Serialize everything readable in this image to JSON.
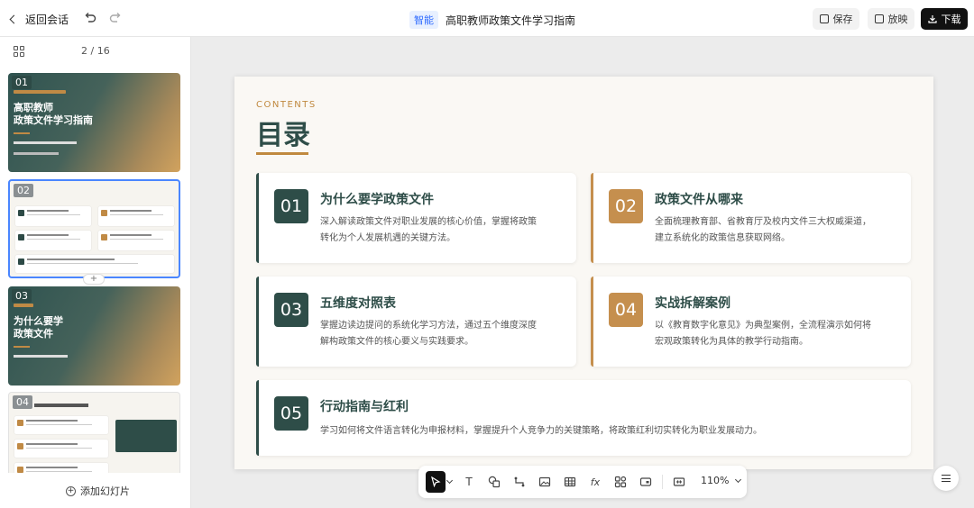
{
  "topbar": {
    "back_label": "返回会话",
    "ai_badge": "智能",
    "doc_title": "高职教师政策文件学习指南",
    "save_label": "保存",
    "present_label": "放映",
    "download_label": "下载"
  },
  "sidebar": {
    "pager": "2 / 16",
    "add_slide_label": "添加幻灯片",
    "thumbnails": [
      {
        "num": "01",
        "title_line1": "高职教师",
        "title_line2": "政策文件学习指南"
      },
      {
        "num": "02"
      },
      {
        "num": "03",
        "title_line1": "为什么要学",
        "title_line2": "政策文件"
      },
      {
        "num": "04"
      }
    ]
  },
  "slide": {
    "eyebrow": "CONTENTS",
    "heading": "目录",
    "items": [
      {
        "num": "01",
        "title": "为什么要学政策文件",
        "desc1": "深入解读政策文件对职业发展的核心价值，掌握将政策",
        "desc2": "转化为个人发展机遇的关键方法。"
      },
      {
        "num": "02",
        "title": "政策文件从哪来",
        "desc1": "全面梳理教育部、省教育厅及校内文件三大权威渠道，",
        "desc2": "建立系统化的政策信息获取网络。"
      },
      {
        "num": "03",
        "title": "五维度对照表",
        "desc1": "掌握边读边提问的系统化学习方法，通过五个维度深度",
        "desc2": "解构政策文件的核心要义与实践要求。"
      },
      {
        "num": "04",
        "title": "实战拆解案例",
        "desc1": "以《教育数字化意见》为典型案例，全流程演示如何将",
        "desc2": "宏观政策转化为具体的教学行动指南。"
      },
      {
        "num": "05",
        "title": "行动指南与红利",
        "desc1": "学习如何将文件语言转化为申报材料，掌握提升个人竞争力的关键策略，将政策红利切实转化为职业发展动力。"
      }
    ]
  },
  "toolbar": {
    "zoom": "110%",
    "text_tool": "T",
    "formula_tool": "fx"
  },
  "colors": {
    "accent_green": "#2e4d48",
    "accent_gold": "#c58f4e",
    "selection_blue": "#4a86ff"
  }
}
